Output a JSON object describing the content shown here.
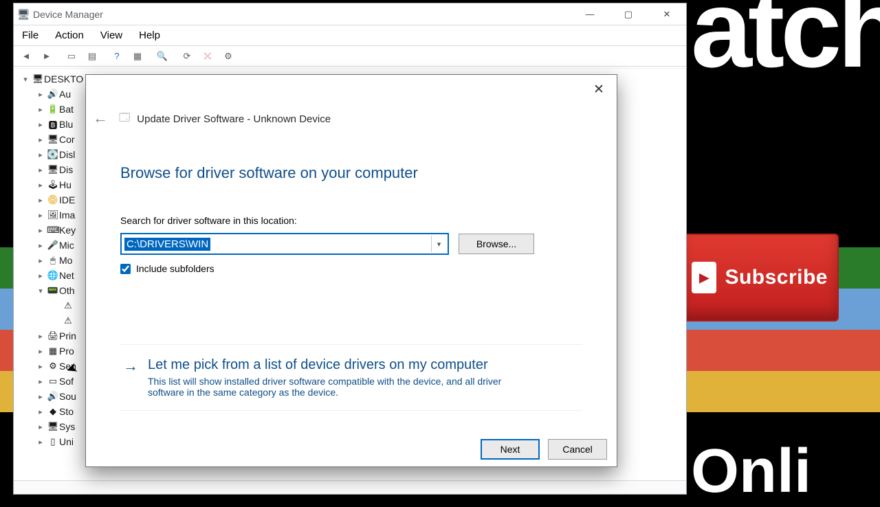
{
  "bg": {
    "text1": "atch",
    "text2": "Onli",
    "subscribe": "Subscribe",
    "sub_icon": "▶"
  },
  "devmgr": {
    "title": "Device Manager",
    "menu": {
      "file": "File",
      "action": "Action",
      "view": "View",
      "help": "Help"
    },
    "tree": {
      "root": "DESKTO",
      "items": [
        "Au",
        "Bat",
        "Blu",
        "Cor",
        "Disl",
        "Dis",
        "Hu",
        "IDE",
        "Ima",
        "Key",
        "Mic",
        "Mo",
        "Net"
      ],
      "other": "Oth",
      "items2": [
        "Prin",
        "Pro",
        "Sen",
        "Sof",
        "Sou",
        "Sto",
        "Sys",
        "Uni"
      ]
    }
  },
  "dlg": {
    "crumb": "Update Driver Software - Unknown Device",
    "title": "Browse for driver software on your computer",
    "search_label": "Search for driver software in this location:",
    "path": "C:\\DRIVERS\\WIN",
    "browse": "Browse...",
    "include": "Include subfolders",
    "pick_title": "Let me pick from a list of device drivers on my computer",
    "pick_desc": "This list will show installed driver software compatible with the device, and all driver software in the same category as the device.",
    "next": "Next",
    "cancel": "Cancel"
  }
}
